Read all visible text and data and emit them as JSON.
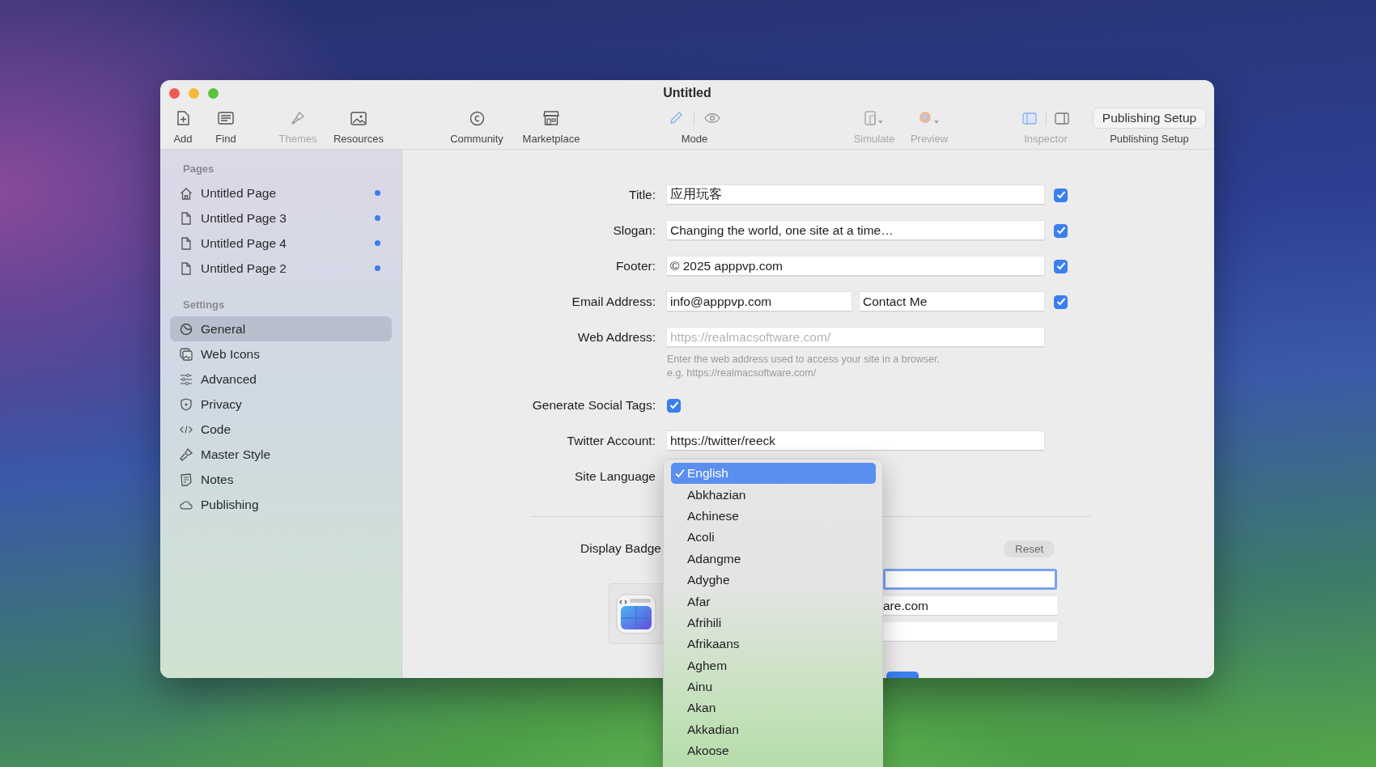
{
  "window": {
    "title": "Untitled"
  },
  "toolbar": [
    {
      "label": "Add",
      "kind": "add",
      "disabled": false
    },
    {
      "label": "Find",
      "kind": "find",
      "disabled": false
    },
    {
      "label": "Themes",
      "kind": "themes",
      "disabled": true
    },
    {
      "label": "Resources",
      "kind": "resources",
      "disabled": false
    },
    {
      "label": "Community",
      "kind": "community",
      "disabled": false
    },
    {
      "label": "Marketplace",
      "kind": "marketplace",
      "disabled": false
    },
    {
      "label": "Mode",
      "kind": "mode",
      "disabled": false
    },
    {
      "label": "Simulate",
      "kind": "simulate",
      "disabled": true
    },
    {
      "label": "Preview",
      "kind": "preview",
      "disabled": true
    },
    {
      "label": "Inspector",
      "kind": "inspector",
      "disabled": true
    },
    {
      "label": "Publishing Setup",
      "kind": "publish",
      "button": "Publishing Setup",
      "disabled": false
    }
  ],
  "sidebar": {
    "sections": [
      {
        "heading": "Pages",
        "items": [
          {
            "label": "Untitled Page",
            "kind": "home",
            "selected": false,
            "modified": true
          },
          {
            "label": "Untitled Page 3",
            "kind": "page",
            "selected": false,
            "modified": true
          },
          {
            "label": "Untitled Page 4",
            "kind": "page",
            "selected": false,
            "modified": true
          },
          {
            "label": "Untitled Page 2",
            "kind": "page",
            "selected": false,
            "modified": true
          }
        ]
      },
      {
        "heading": "Settings",
        "items": [
          {
            "label": "General",
            "kind": "general",
            "selected": true
          },
          {
            "label": "Web Icons",
            "kind": "webicons",
            "selected": false
          },
          {
            "label": "Advanced",
            "kind": "advanced",
            "selected": false
          },
          {
            "label": "Privacy",
            "kind": "privacy",
            "selected": false
          },
          {
            "label": "Code",
            "kind": "code",
            "selected": false
          },
          {
            "label": "Master Style",
            "kind": "style",
            "selected": false
          },
          {
            "label": "Notes",
            "kind": "notes",
            "selected": false
          },
          {
            "label": "Publishing",
            "kind": "publishing",
            "selected": false
          }
        ]
      }
    ]
  },
  "form": {
    "rows": [
      {
        "label": "Title:",
        "kind": "text",
        "value": "应用玩客",
        "checked": true
      },
      {
        "label": "Slogan:",
        "kind": "text",
        "value": "Changing the world, one site at a time…",
        "checked": true
      },
      {
        "label": "Footer:",
        "kind": "text",
        "value": "© 2025 apppvp.com",
        "checked": true
      },
      {
        "label": "Email Address:",
        "kind": "pair",
        "value": "info@apppvp.com",
        "value2": "Contact Me",
        "checked": true
      },
      {
        "label": "Web Address:",
        "kind": "text",
        "placeholder": "https://realmacsoftware.com/",
        "help": [
          "Enter the web address used to access your site in a browser.",
          "e.g. https://realmacsoftware.com/"
        ]
      },
      {
        "label": "Generate Social Tags:",
        "kind": "checkbox",
        "checked": true
      },
      {
        "label": "Twitter Account:",
        "kind": "text",
        "value": "https://twitter/reeck"
      },
      {
        "label": "Site Language",
        "kind": "select"
      }
    ]
  },
  "badge": {
    "label": "Display Badge",
    "reset": "Reset",
    "fields": [
      {
        "focused": true
      },
      {
        "value": "are.com",
        "focused": false
      },
      {
        "focused": false
      }
    ]
  },
  "language_menu": {
    "items": [
      {
        "label": "English",
        "selected": true
      },
      {
        "label": "Abkhazian",
        "selected": false
      },
      {
        "label": "Achinese",
        "selected": false
      },
      {
        "label": "Acoli",
        "selected": false
      },
      {
        "label": "Adangme",
        "selected": false
      },
      {
        "label": "Adyghe",
        "selected": false
      },
      {
        "label": "Afar",
        "selected": false
      },
      {
        "label": "Afrihili",
        "selected": false
      },
      {
        "label": "Afrikaans",
        "selected": false
      },
      {
        "label": "Aghem",
        "selected": false
      },
      {
        "label": "Ainu",
        "selected": false
      },
      {
        "label": "Akan",
        "selected": false
      },
      {
        "label": "Akkadian",
        "selected": false
      },
      {
        "label": "Akoose",
        "selected": false
      }
    ]
  }
}
